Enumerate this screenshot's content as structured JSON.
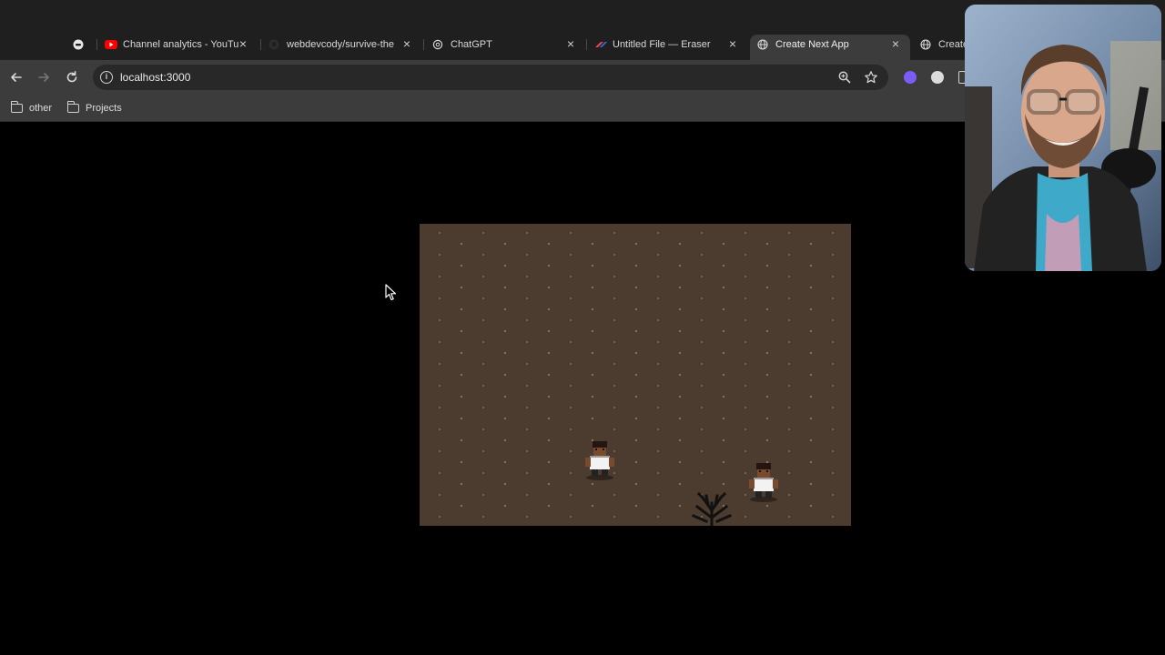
{
  "tabs": [
    {
      "label": "",
      "icon": "generic-favicon-icon"
    },
    {
      "label": "Channel analytics - YouTu",
      "icon": "youtube-icon"
    },
    {
      "label": "webdevcody/survive-the",
      "icon": "github-icon"
    },
    {
      "label": "ChatGPT",
      "icon": "chatgpt-icon"
    },
    {
      "label": "Untitled File — Eraser",
      "icon": "eraser-icon"
    },
    {
      "label": "Create Next App",
      "icon": "globe-icon",
      "active": true
    },
    {
      "label": "Create",
      "icon": "globe-icon"
    }
  ],
  "toolbar": {
    "url": "localhost:3000"
  },
  "bookmarks": [
    {
      "label": "other",
      "icon": "folder-icon"
    },
    {
      "label": "Projects",
      "icon": "folder-icon"
    }
  ],
  "colors": {
    "ground": "#4c3c30",
    "tab_strip": "#1f1f1f",
    "toolbar": "#3c3c3c",
    "omnibox": "#282828"
  }
}
